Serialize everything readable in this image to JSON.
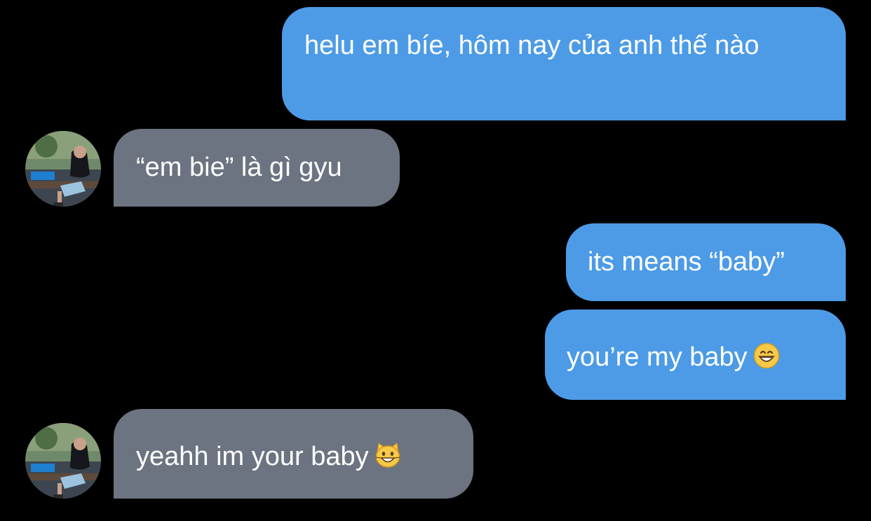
{
  "colors": {
    "background": "#000000",
    "sent_bubble": "#4d9be6",
    "received_bubble": "#6b7480",
    "text": "#ffffff"
  },
  "messages": [
    {
      "direction": "sent",
      "text": "helu em bíe, hôm nay của anh thế nào"
    },
    {
      "direction": "received",
      "text": "“em bie” là gì gyu",
      "avatar": "contact-avatar"
    },
    {
      "direction": "sent",
      "text": "its means “baby”"
    },
    {
      "direction": "sent",
      "text": "you’re my baby",
      "emoji": "grinning-face-icon"
    },
    {
      "direction": "received",
      "text": "yeahh im your baby",
      "emoji": "grinning-cat-icon",
      "avatar": "contact-avatar"
    }
  ]
}
